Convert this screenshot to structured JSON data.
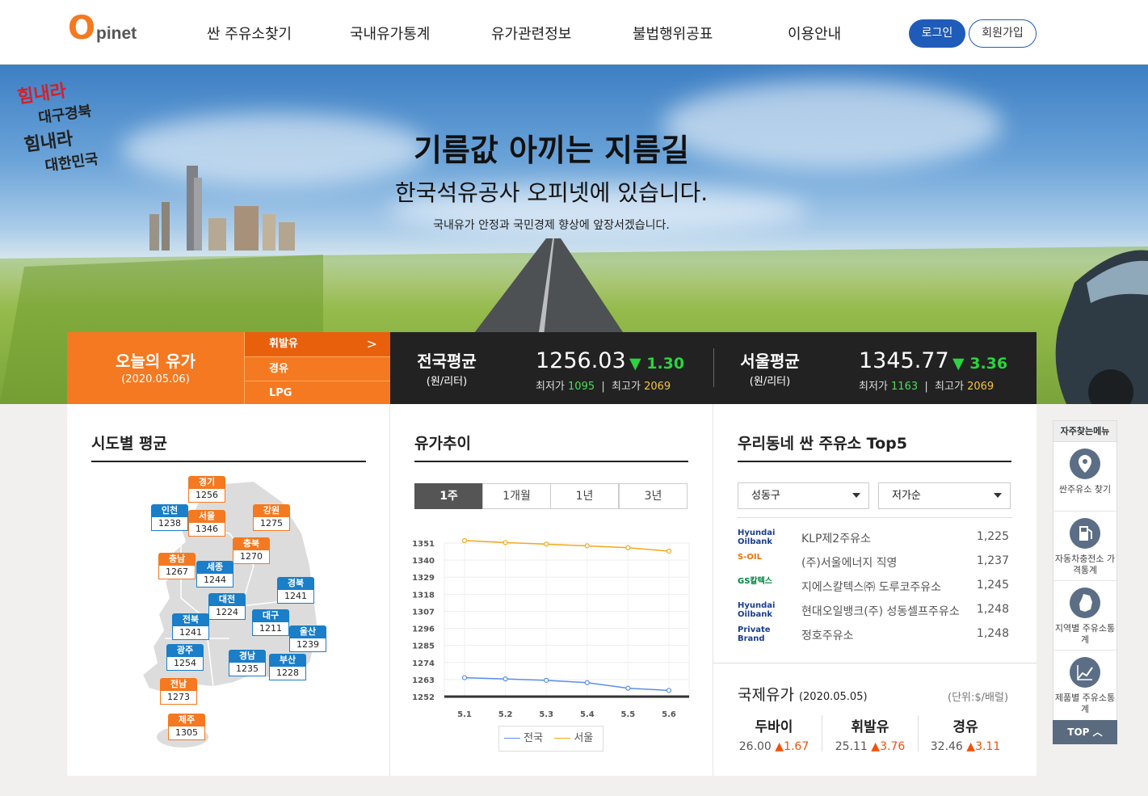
{
  "header": {
    "logo_big": "O",
    "logo_rest": "pinet",
    "nav": [
      "싼 주유소찾기",
      "국내유가통계",
      "유가관련정보",
      "불법행위공표",
      "이용안내"
    ],
    "login": "로그인",
    "join": "회원가입"
  },
  "hero": {
    "slogan_lines": [
      "힘내라",
      "대구경북",
      "힘내라",
      "대한민국"
    ],
    "title": "기름값 아끼는 지름길",
    "subtitle": "한국석유공사 오피넷에 있습니다.",
    "desc": "국내유가 안정과 국민경제 향상에 앞장서겠습니다."
  },
  "price_bar": {
    "today_title": "오늘의 유가",
    "today_date": "(2020.05.06)",
    "tabs": [
      "휘발유",
      "경유",
      "LPG"
    ],
    "national": {
      "label": "전국평균",
      "unit": "(원/리터)",
      "value": "1256.03",
      "diff": "▼ 1.30",
      "min_label": "최저가",
      "min": "1095",
      "max_label": "최고가",
      "max": "2069"
    },
    "seoul": {
      "label": "서울평균",
      "unit": "(원/리터)",
      "value": "1345.77",
      "diff": "▼ 3.36",
      "min_label": "최저가",
      "min": "1163",
      "max_label": "최고가",
      "max": "2069"
    },
    "sep": "|"
  },
  "sido": {
    "title": "시도별 평균",
    "regions": [
      {
        "name": "경기",
        "value": "1256",
        "color": "orange"
      },
      {
        "name": "인천",
        "value": "1238",
        "color": "blue"
      },
      {
        "name": "서울",
        "value": "1346",
        "color": "orange"
      },
      {
        "name": "강원",
        "value": "1275",
        "color": "orange"
      },
      {
        "name": "충북",
        "value": "1270",
        "color": "orange"
      },
      {
        "name": "충남",
        "value": "1267",
        "color": "orange"
      },
      {
        "name": "세종",
        "value": "1244",
        "color": "blue"
      },
      {
        "name": "경북",
        "value": "1241",
        "color": "blue"
      },
      {
        "name": "대전",
        "value": "1224",
        "color": "blue"
      },
      {
        "name": "대구",
        "value": "1211",
        "color": "blue"
      },
      {
        "name": "전북",
        "value": "1241",
        "color": "blue"
      },
      {
        "name": "울산",
        "value": "1239",
        "color": "blue"
      },
      {
        "name": "광주",
        "value": "1254",
        "color": "blue"
      },
      {
        "name": "경남",
        "value": "1235",
        "color": "blue"
      },
      {
        "name": "부산",
        "value": "1228",
        "color": "blue"
      },
      {
        "name": "전남",
        "value": "1273",
        "color": "orange"
      },
      {
        "name": "제주",
        "value": "1305",
        "color": "orange"
      }
    ]
  },
  "trend": {
    "title": "유가추이",
    "tabs": [
      "1주",
      "1개월",
      "1년",
      "3년"
    ],
    "legend": [
      "전국",
      "서울"
    ]
  },
  "chart_data": {
    "type": "line",
    "title": "유가추이",
    "categories": [
      "5.1",
      "5.2",
      "5.3",
      "5.4",
      "5.5",
      "5.6"
    ],
    "y_ticks": [
      "1351",
      "1340",
      "1329",
      "1318",
      "1307",
      "1296",
      "1285",
      "1274",
      "1263",
      "1252"
    ],
    "ylim": [
      1252,
      1351
    ],
    "series": [
      {
        "name": "전국",
        "color": "#5b8ee8",
        "values": [
          1264.2,
          1263.4,
          1262.5,
          1261.0,
          1257.4,
          1256.0
        ]
      },
      {
        "name": "서울",
        "color": "#f2a91b",
        "values": [
          1352.6,
          1351.3,
          1350.3,
          1349.2,
          1348.0,
          1345.8
        ]
      }
    ],
    "grid": true,
    "legend": "bottom"
  },
  "top5": {
    "title": "우리동네 싼 주유소 Top5",
    "district": "성동구",
    "order": "저가순",
    "stations": [
      {
        "brand": "Hyundai Oilbank",
        "name": "KLP제2주유소",
        "price": "1,225"
      },
      {
        "brand": "S-OIL",
        "name": "(주)서울에너지 직영",
        "price": "1,237"
      },
      {
        "brand": "GS칼텍스",
        "name": "지에스칼텍스㈜ 도루코주유소",
        "price": "1,245"
      },
      {
        "brand": "Hyundai Oilbank",
        "name": "현대오일뱅크(주) 성동셀프주유소",
        "price": "1,248"
      },
      {
        "brand": "Private Brand",
        "name": "정호주유소",
        "price": "1,248"
      }
    ]
  },
  "intl": {
    "title": "국제유가",
    "date": "(2020.05.05)",
    "unit": "(단위:$/배럴)",
    "items": [
      {
        "name": "두바이",
        "value": "26.00",
        "diff": "▲1.67"
      },
      {
        "name": "휘발유",
        "value": "25.11",
        "diff": "▲3.76"
      },
      {
        "name": "경유",
        "value": "32.46",
        "diff": "▲3.11"
      }
    ]
  },
  "quick": {
    "title": "자주찾는메뉴",
    "items": [
      "싼주유소 찾기",
      "자동차충전소 가격통계",
      "지역별 주유소통계",
      "제품별 주유소통계"
    ],
    "top": "TOP"
  }
}
